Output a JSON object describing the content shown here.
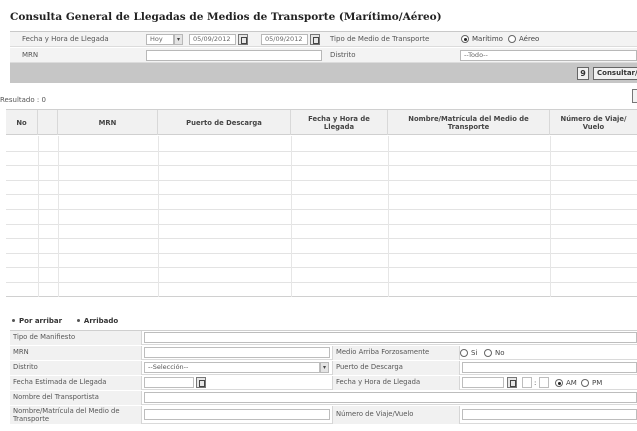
{
  "page": {
    "title": "Consulta General de Llegadas de Medios de Transporte (Marítimo/Aéreo)"
  },
  "search": {
    "date_label": "Fecha y Hora de Llegada",
    "period_value": "Hoy",
    "date_from": "05/09/2012",
    "date_to": "05/09/2012",
    "transport_type_label": "Tipo de Medio de Transporte",
    "transport_options": [
      "Marítimo",
      "Aéreo"
    ],
    "transport_selected": "Marítimo",
    "mrn_label": "MRN",
    "mrn_value": "",
    "district_label": "Distrito",
    "district_value": "--Todo--"
  },
  "actions": {
    "query_label": "Consultar/"
  },
  "results": {
    "label": "Resultado : 0"
  },
  "grid": {
    "columns": [
      "No",
      "MRN",
      "Puerto de Descarga",
      "Fecha y Hora de Llegada",
      "Nombre/Matrícula del Medio de Transporte",
      "Número de Viaje/ Vuelo"
    ],
    "rows": []
  },
  "legend": {
    "items": [
      "Por arribar",
      "Arribado"
    ]
  },
  "detail": {
    "manifest_type_label": "Tipo de Manifiesto",
    "mrn_label": "MRN",
    "forced_arrival_label": "Medio Arriba Forzosamente",
    "forced_options": [
      "Si",
      "No"
    ],
    "district_label": "Distrito",
    "district_value": "--Selección--",
    "port_label": "Puerto de Descarga",
    "est_date_label": "Fecha Estimada de Llegada",
    "arrival_label": "Fecha y Hora de Llegada",
    "ampm_options": [
      "AM",
      "PM"
    ],
    "ampm_selected": "AM",
    "carrier_label": "Nombre del Transportista",
    "vessel_label": "Nombre/Matrícula del Medio de Transporte",
    "voyage_label": "Número de Viaje/Vuelo"
  }
}
